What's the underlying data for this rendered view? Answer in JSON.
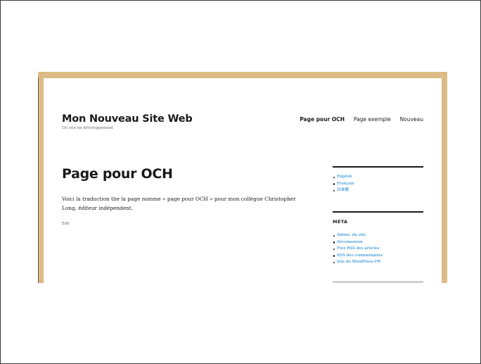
{
  "site": {
    "title": "Mon Nouveau Site Web",
    "description": "Un site en développement"
  },
  "nav": {
    "items": [
      {
        "label": "Page pour OCH",
        "current": true
      },
      {
        "label": "Page exemple",
        "current": false
      },
      {
        "label": "Nouveau",
        "current": false
      }
    ]
  },
  "page": {
    "title": "Page pour OCH",
    "content": "Voici la traduction the la page  nomme « page pour OCH » pour mon collègue Christopher Long, éditeur indépendent.",
    "edit_label": "Edit"
  },
  "sidebar": {
    "languages": [
      "English",
      "Français",
      "日本語"
    ],
    "meta": {
      "title": "MÉTA",
      "links": [
        "Admin. du site",
        "Déconnexion",
        "Flux RSS des articles",
        "RSS des commentaires",
        "Site de WordPress-FR"
      ]
    }
  },
  "colors": {
    "border_accent": "#dcbb84",
    "link": "#007acc",
    "text": "#1a1a1a",
    "muted": "#686868"
  }
}
